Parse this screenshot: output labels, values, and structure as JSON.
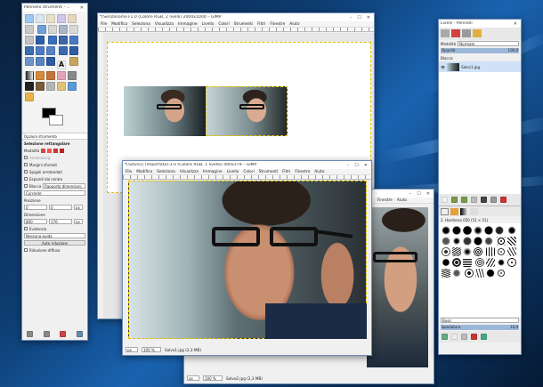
{
  "toolbox": {
    "title": "Pannello strumenti - ...",
    "tool_options_tab": "Opzioni strumento",
    "options_title": "Selezione rettangolare",
    "mode_label": "Modalità",
    "antialiasing": "Antialiasing",
    "feather": "Margini sfumati",
    "rounded": "Spigoli arrotondati",
    "expand_center": "Espandi dal centro",
    "fixed": "Blocca",
    "fixed_value": "Rapporto dimensioni",
    "current": "Corrente",
    "position_label": "Posizione",
    "position_x": "0",
    "position_y": "0",
    "position_unit": "px",
    "size_label": "Dimensione",
    "size_w": "800",
    "size_h": "176",
    "size_unit": "px",
    "highlight": "Evidenzia",
    "guides": "Nessuna guida",
    "autoshrink": "Auto riduzione",
    "shrink_merged": "Riduzione diffusa"
  },
  "main_window": {
    "title": "*[Senzanome]-1.0 (Colore RGB, 2 livelli) 2000x1000 – GIMP",
    "menu": [
      "File",
      "Modifica",
      "Seleziona",
      "Visualizza",
      "Immagine",
      "Livello",
      "Colori",
      "Strumenti",
      "Filtri",
      "Finestre",
      "Aiuto"
    ]
  },
  "salvo1_window": {
    "title": "*[Salvo1] (importata)-3.0 (Colore RGB, 1 livello) 400x379 – GIMP",
    "menu": [
      "File",
      "Modifica",
      "Seleziona",
      "Visualizza",
      "Immagine",
      "Livello",
      "Colori",
      "Strumenti",
      "Filtri",
      "Finestre",
      "Aiuto"
    ],
    "unit": "px",
    "zoom": "100 %",
    "status": "Salvo1.jpg (2,3 MB)"
  },
  "salvo2_window": {
    "menu": [
      "Finestre",
      "Aiuto"
    ],
    "unit": "px",
    "zoom": "100 %",
    "status": "Salvo2.jpg (2,3 MB)"
  },
  "layers": {
    "title": "Livelli - Pennelli",
    "mode_label": "Modalità",
    "mode_value": "Normale",
    "opacity_label": "Opacità",
    "opacity_value": "100,0",
    "lock_label": "Blocca:",
    "layer_name": "Salvo1.jpg",
    "brushes_title": "2. Hardness 050 (51 × 51)",
    "brush_tag": "Basic",
    "spacing_label": "Spaziatura",
    "spacing_value": "10,0"
  }
}
